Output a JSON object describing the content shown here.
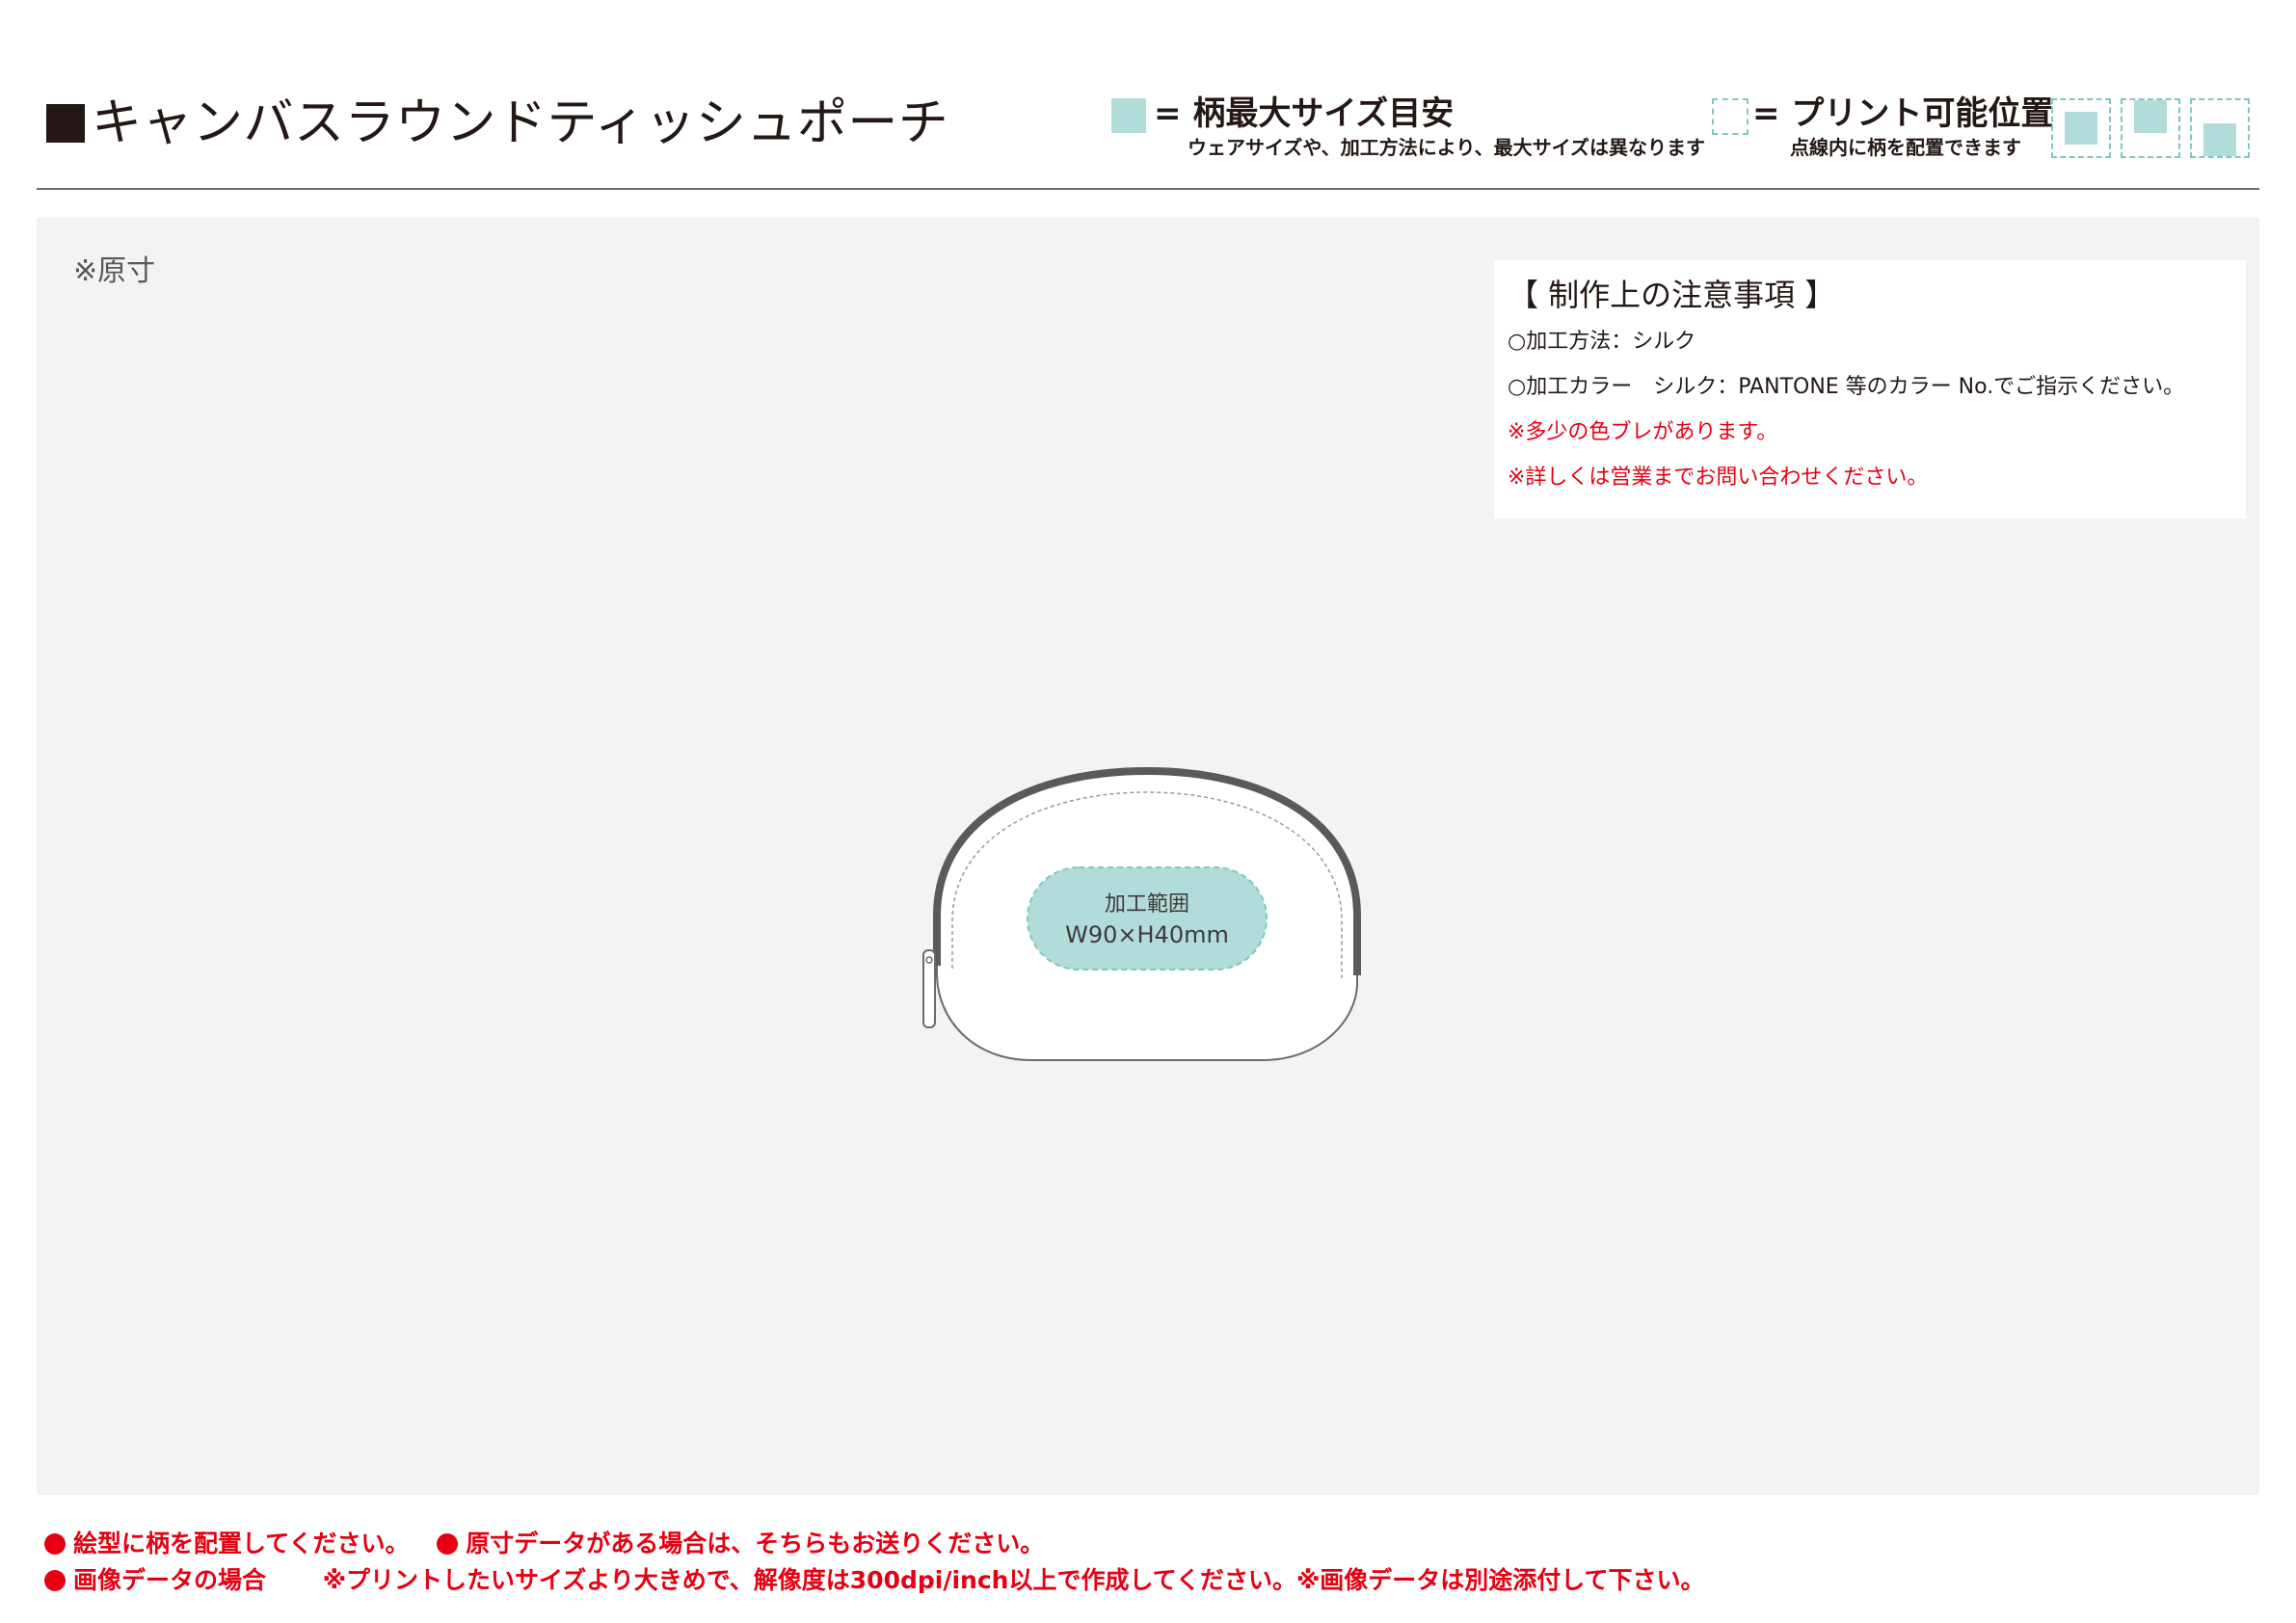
{
  "header": {
    "title": "キャンバスラウンドティッシュポーチ",
    "legend_max_size": {
      "label": "= 柄最大サイズ目安",
      "sub": "ウェアサイズや、加工方法により、最大サイズは異なります",
      "color": "#b2dcd9"
    },
    "legend_print_position": {
      "label": "= プリント可能位置",
      "sub": "点線内に柄を配置できます",
      "border_color": "#7ec8c4"
    }
  },
  "canvas": {
    "scale_note": "※原寸",
    "notes": {
      "title": "【 制作上の注意事項 】",
      "lines": [
        "○加工方法：シルク",
        "○加工カラー　シルク：PANTONE 等のカラー No.でご指示ください。",
        "※多少の色ブレがあります。",
        "※詳しくは営業までお問い合わせください。"
      ]
    },
    "print_area": {
      "label": "加工範囲",
      "size": "W90×H40mm"
    }
  },
  "footer": {
    "line1": [
      "絵型に柄を配置してください。",
      "原寸データがある場合は、そちらもお送りください。"
    ],
    "line2": [
      "画像データの場合",
      "※プリントしたいサイズより大きめで、解像度は300dpi/inch以上で作成してください。※画像データは別途添付して下さい。"
    ],
    "accent_color": "#e60012"
  }
}
